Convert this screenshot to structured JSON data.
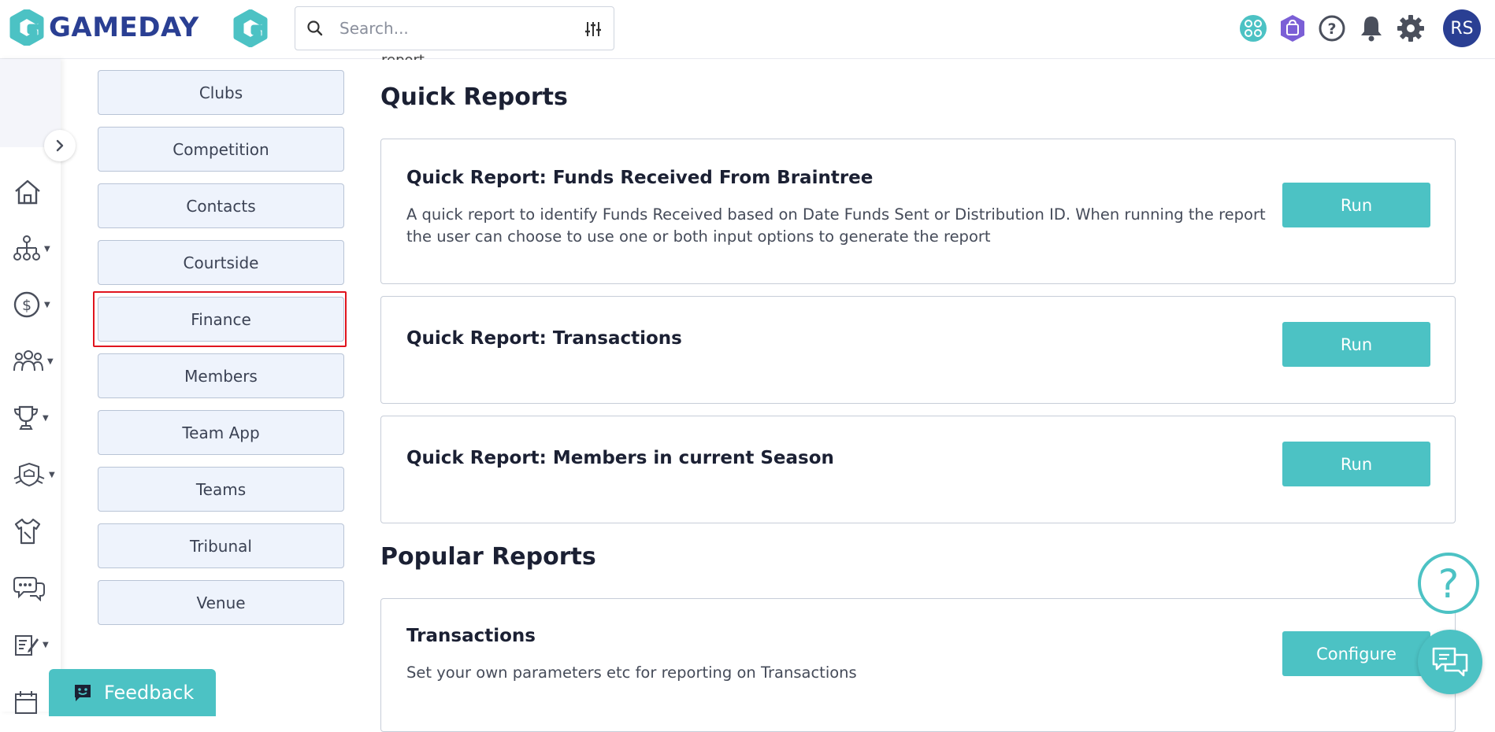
{
  "brand": {
    "name": "GAMEDAY",
    "color": "#2a3f93",
    "accent": "#4cc2c4"
  },
  "search": {
    "placeholder": "Search..."
  },
  "header_icons": [
    "people-network-icon",
    "shopping-bag-icon",
    "help-icon",
    "bell-icon",
    "gear-icon"
  ],
  "user": {
    "initials": "RS"
  },
  "rail_icons": [
    "home-icon",
    "org-chart-icon",
    "dollar-icon",
    "members-group-icon",
    "trophy-icon",
    "team-shield-icon",
    "jersey-icon",
    "chat-icon",
    "edit-form-icon",
    "calendar-icon"
  ],
  "categories": [
    "Clubs",
    "Competition",
    "Contacts",
    "Courtside",
    "Finance",
    "Members",
    "Team App",
    "Teams",
    "Tribunal",
    "Venue"
  ],
  "selected_category": "Finance",
  "partial_text": "report.",
  "quick_reports": {
    "title": "Quick Reports",
    "items": [
      {
        "title": "Quick Report: Funds Received From Braintree",
        "description": "A quick report to identify Funds Received based on Date Funds Sent or Distribution ID. When running the report the user can choose to use one or both input options to generate the report",
        "button": "Run"
      },
      {
        "title": "Quick Report: Transactions",
        "description": "",
        "button": "Run"
      },
      {
        "title": "Quick Report: Members in current Season",
        "description": "",
        "button": "Run"
      }
    ]
  },
  "popular_reports": {
    "title": "Popular Reports",
    "items": [
      {
        "title": "Transactions",
        "description": "Set your own parameters etc for reporting on Transactions",
        "button": "Configure"
      }
    ]
  },
  "feedback": {
    "label": "Feedback"
  }
}
